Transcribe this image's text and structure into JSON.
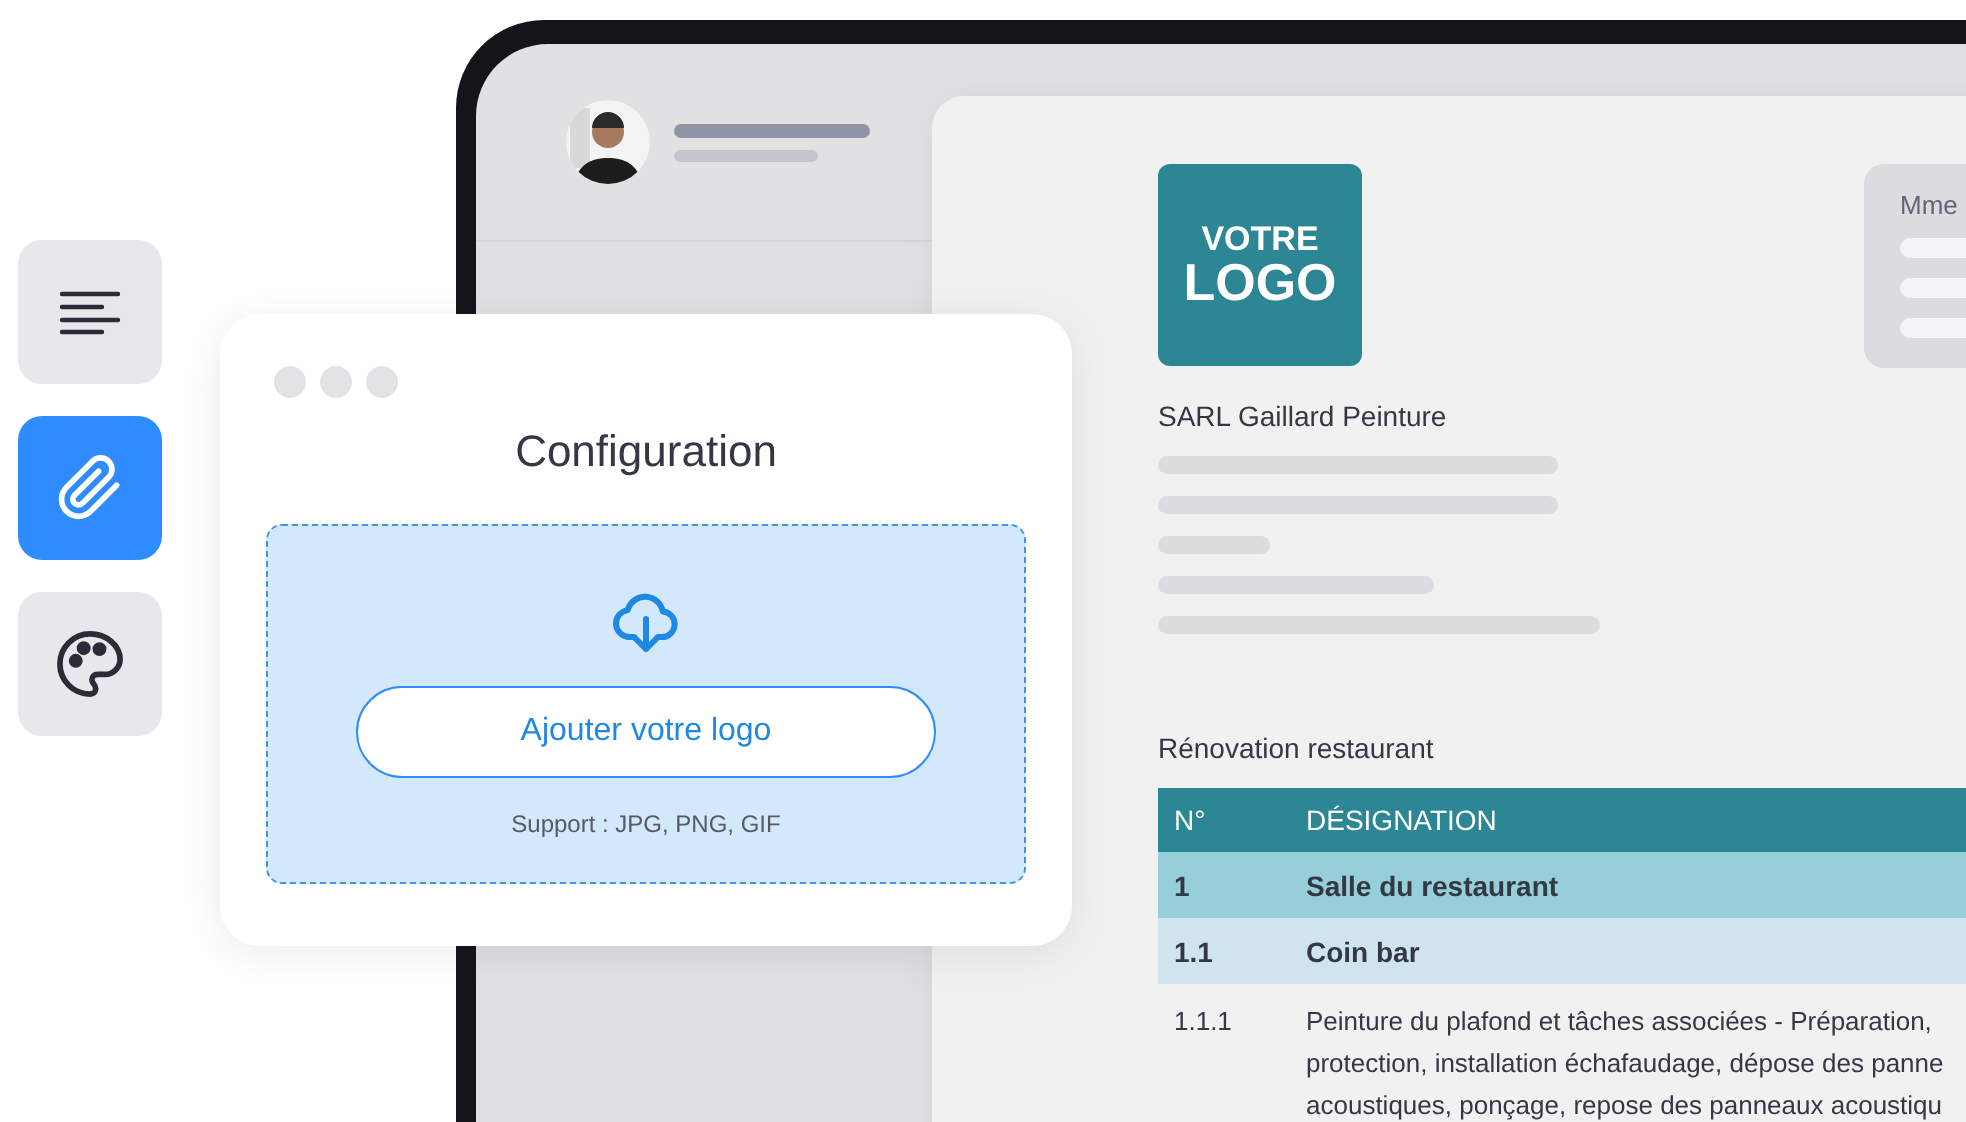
{
  "tools": [
    {
      "kind": "menu",
      "selected": false
    },
    {
      "kind": "attach",
      "selected": true
    },
    {
      "kind": "palette",
      "selected": false
    }
  ],
  "config": {
    "title": "Configuration",
    "button": "Ajouter votre logo",
    "support": "Support : JPG, PNG, GIF"
  },
  "document": {
    "logo": [
      "VOTRE",
      "LOGO"
    ],
    "company": "SARL Gaillard Peinture",
    "client_label": "Mme",
    "project": "Rénovation restaurant",
    "table": {
      "columns": [
        "N°",
        "DÉSIGNATION"
      ],
      "rows": [
        {
          "kind": "group",
          "number": "1",
          "label": "Salle du restaurant"
        },
        {
          "kind": "subgroup",
          "number": "1.1",
          "label": "Coin bar"
        },
        {
          "kind": "item",
          "number": "1.1.1",
          "lines": [
            "Peinture du plafond et tâches associées - Préparation,",
            "protection, installation échafaudage, dépose des panne",
            "acoustiques, ponçage, repose des panneaux acoustiqu"
          ]
        }
      ]
    }
  }
}
